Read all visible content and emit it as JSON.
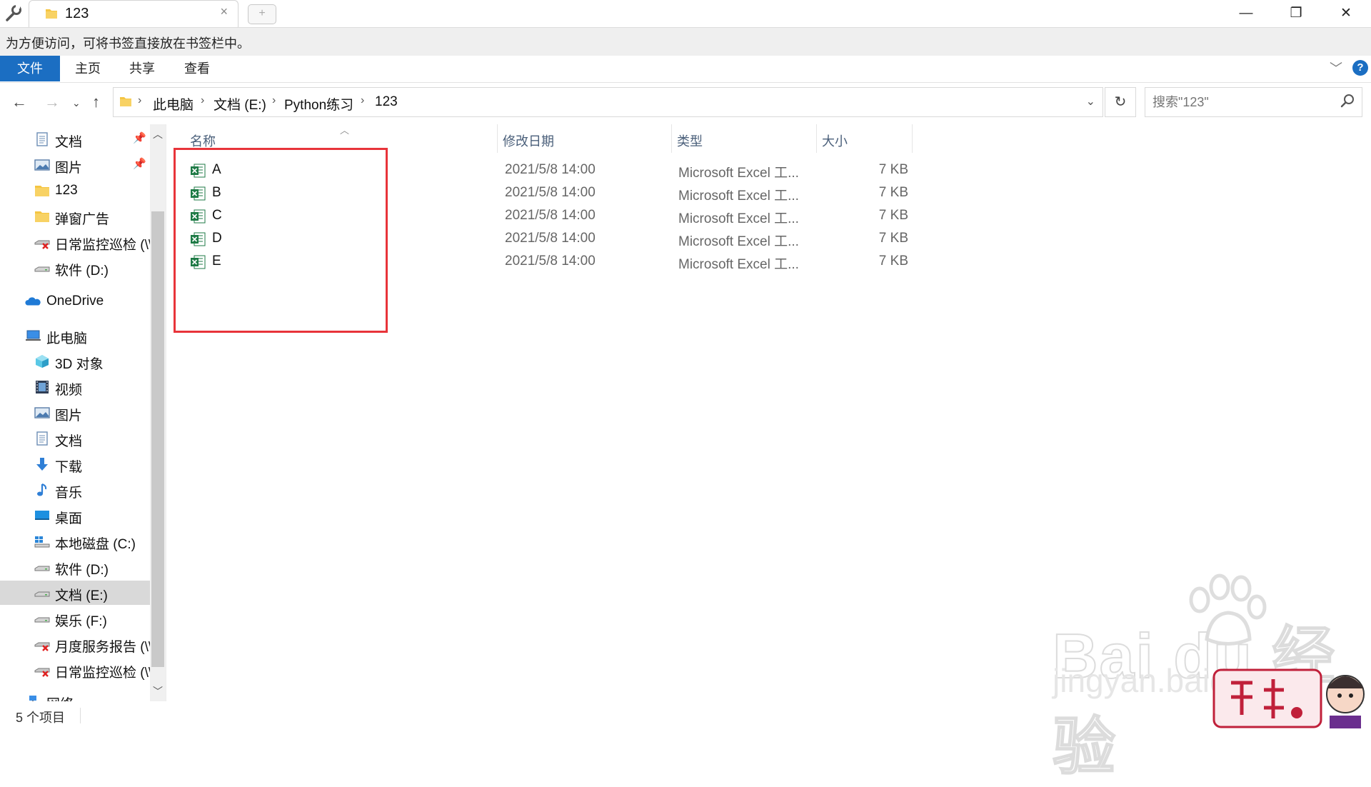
{
  "window": {
    "tab_title": "123",
    "tab_close": "×",
    "new_tab": "+",
    "controls": {
      "minimize": "—",
      "restore": "❐",
      "close": "✕"
    }
  },
  "bookmark_bar": {
    "hint": "为方便访问，可将书签直接放在书签栏中。"
  },
  "ribbon": {
    "tabs": [
      "文件",
      "主页",
      "共享",
      "查看"
    ],
    "help": "?"
  },
  "address": {
    "crumbs": [
      "此电脑",
      "文档 (E:)",
      "Python练习",
      "123"
    ],
    "search_placeholder": "搜索\"123\""
  },
  "sidebar": {
    "items": [
      {
        "label": "文档",
        "icon": "document-icon",
        "pinned": true
      },
      {
        "label": "图片",
        "icon": "picture-icon",
        "pinned": true
      },
      {
        "label": "123",
        "icon": "folder-icon"
      },
      {
        "label": "弹窗广告",
        "icon": "folder-icon"
      },
      {
        "label": "日常监控巡检 (\\\\",
        "icon": "network-drive-disconnected-icon"
      },
      {
        "label": "软件 (D:)",
        "icon": "drive-icon"
      },
      {
        "label": "OneDrive",
        "icon": "onedrive-icon"
      },
      {
        "label": "此电脑",
        "icon": "this-pc-icon"
      },
      {
        "label": "3D 对象",
        "icon": "3d-objects-icon"
      },
      {
        "label": "视频",
        "icon": "video-icon"
      },
      {
        "label": "图片",
        "icon": "picture-icon"
      },
      {
        "label": "文档",
        "icon": "document-icon"
      },
      {
        "label": "下载",
        "icon": "download-icon"
      },
      {
        "label": "音乐",
        "icon": "music-icon"
      },
      {
        "label": "桌面",
        "icon": "desktop-icon"
      },
      {
        "label": "本地磁盘 (C:)",
        "icon": "windows-drive-icon"
      },
      {
        "label": "软件 (D:)",
        "icon": "drive-icon"
      },
      {
        "label": "文档 (E:)",
        "icon": "drive-icon",
        "selected": true
      },
      {
        "label": "娱乐 (F:)",
        "icon": "drive-icon"
      },
      {
        "label": "月度服务报告 (\\\\",
        "icon": "network-drive-disconnected-icon"
      },
      {
        "label": "日常监控巡检 (\\\\",
        "icon": "network-drive-disconnected-icon"
      },
      {
        "label": "网络",
        "icon": "network-icon"
      }
    ]
  },
  "columns": [
    "名称",
    "修改日期",
    "类型",
    "大小"
  ],
  "files": [
    {
      "name": "A",
      "date": "2021/5/8 14:00",
      "type": "Microsoft Excel 工...",
      "size": "7 KB"
    },
    {
      "name": "B",
      "date": "2021/5/8 14:00",
      "type": "Microsoft Excel 工...",
      "size": "7 KB"
    },
    {
      "name": "C",
      "date": "2021/5/8 14:00",
      "type": "Microsoft Excel 工...",
      "size": "7 KB"
    },
    {
      "name": "D",
      "date": "2021/5/8 14:00",
      "type": "Microsoft Excel 工...",
      "size": "7 KB"
    },
    {
      "name": "E",
      "date": "2021/5/8 14:00",
      "type": "Microsoft Excel 工...",
      "size": "7 KB"
    }
  ],
  "status": {
    "item_count": "5 个项目"
  },
  "colors": {
    "accent": "#1b6ec2",
    "highlight_box": "#e8343a",
    "excel_green": "#1d7a45"
  }
}
